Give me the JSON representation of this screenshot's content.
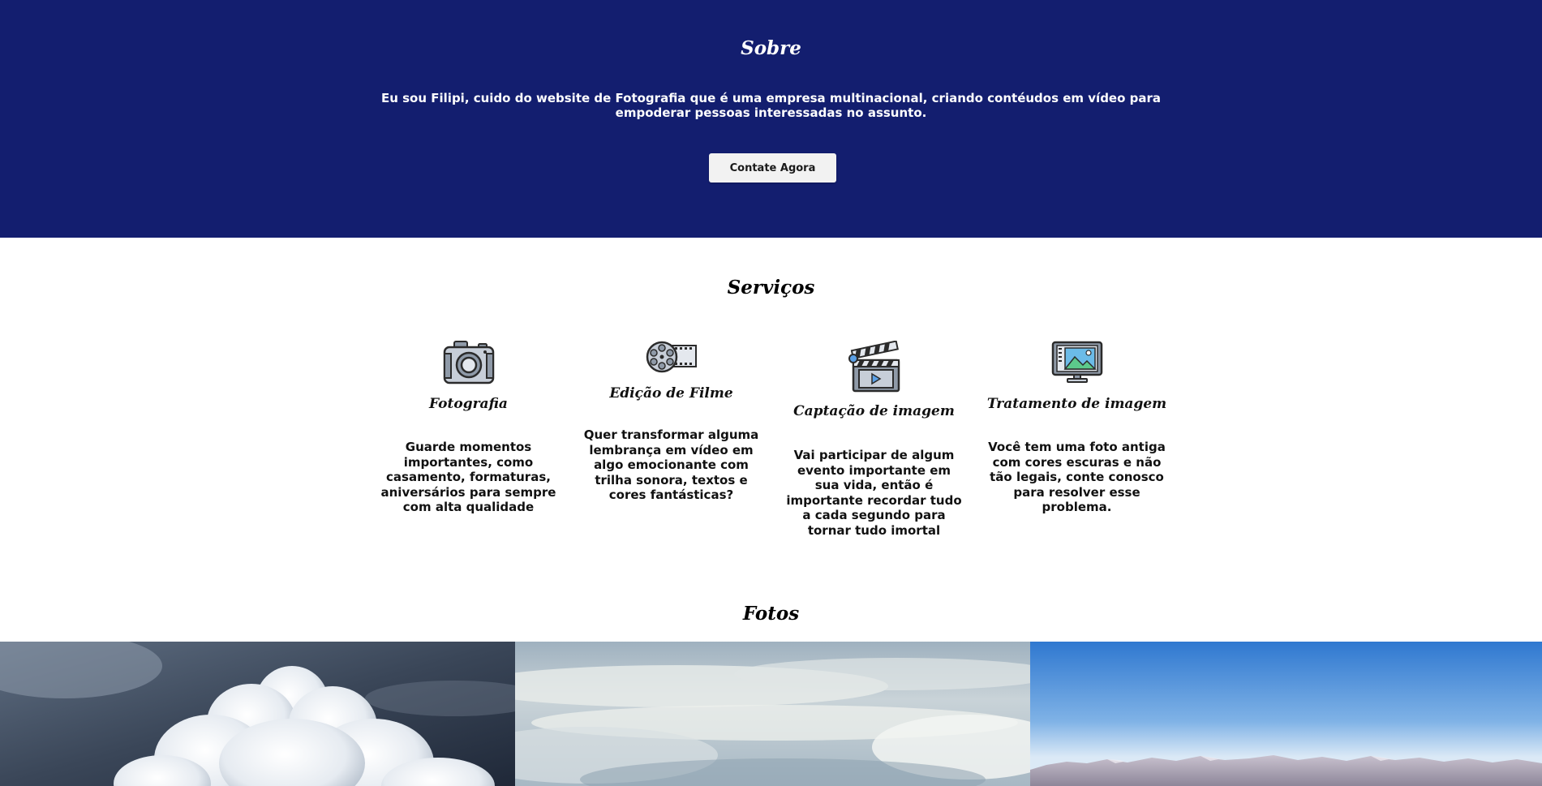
{
  "about": {
    "title": "Sobre",
    "text": "Eu sou Filipi, cuido do website de Fotografia que é uma empresa multinacional, criando contéudos em vídeo para empoderar pessoas interessadas no assunto.",
    "button_label": "Contate Agora"
  },
  "services": {
    "title": "Serviços",
    "items": [
      {
        "icon": "camera-icon",
        "name": "Fotografia",
        "description": "Guarde momentos importantes, como casamento, formaturas, aniversários para sempre com alta qualidade"
      },
      {
        "icon": "film-reel-icon",
        "name": "Edição de Filme",
        "description": "Quer transformar alguma lembrança em vídeo em algo emocionante com trilha sonora, textos e cores fantásticas?"
      },
      {
        "icon": "clapperboard-icon",
        "name": "Captação de imagem",
        "description": "Vai participar de algum evento importante em sua vida, então é importante recordar tudo a cada segundo para tornar tudo imortal"
      },
      {
        "icon": "monitor-image-icon",
        "name": "Tratamento de imagem",
        "description": "Você tem uma foto antiga com cores escuras e não tão legais, conte conosco para resolver esse problema."
      }
    ]
  },
  "photos": {
    "title": "Fotos",
    "items": [
      {
        "subject": "cumulus-cloud-photo"
      },
      {
        "subject": "cloudy-sky-photo"
      },
      {
        "subject": "mountains-blue-sky-photo"
      }
    ]
  },
  "colors": {
    "about_background": "#131e6f",
    "button_background": "#f2f2f2"
  }
}
